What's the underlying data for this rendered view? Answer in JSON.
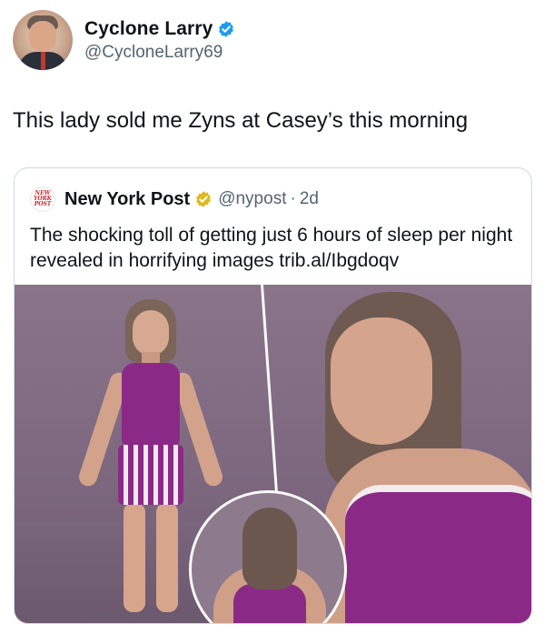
{
  "tweet": {
    "author": {
      "display_name": "Cyclone Larry",
      "handle": "@CycloneLarry69",
      "verified_badge": "blue-check-icon"
    },
    "text": "This lady sold me Zyns at Casey’s this morning",
    "quoted": {
      "author": {
        "display_name": "New York Post",
        "logo_text": "NEW YORK POST",
        "handle": "@nypost",
        "separator": "·",
        "time": "2d",
        "verified_badge": "gold-check-icon"
      },
      "text": "The shocking toll of getting just 6 hours of sleep per night revealed in horrifying images trib.al/Ibgdoqv"
    }
  },
  "colors": {
    "text_primary": "#0f1419",
    "text_secondary": "#536471",
    "verified_blue": "#1d9bf0",
    "verified_gold": "#e2b719",
    "card_border": "#cfd9de",
    "image_background": "#7d6880",
    "tank_top_purple": "#8b2a86"
  }
}
